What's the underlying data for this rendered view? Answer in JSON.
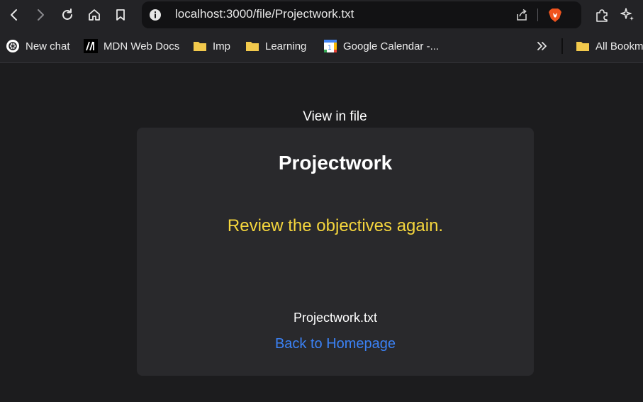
{
  "browser": {
    "url": "localhost:3000/file/Projectwork.txt",
    "bookmarks": [
      {
        "label": "New chat",
        "icon": "chatgpt-icon"
      },
      {
        "label": "MDN Web Docs",
        "icon": "mdn-icon"
      },
      {
        "label": "Imp",
        "icon": "folder-icon"
      },
      {
        "label": "Learning",
        "icon": "folder-icon"
      },
      {
        "label": "Google Calendar -...",
        "icon": "google-calendar-icon"
      }
    ],
    "all_bookmarks_label": "All Bookm"
  },
  "page": {
    "heading": "View in file",
    "title": "Projectwork",
    "body": "Review the objectives again.",
    "filename": "Projectwork.txt",
    "back_link": "Back to Homepage"
  },
  "colors": {
    "background": "#1c1c1e",
    "card": "#29292c",
    "body_text": "#f5d63d",
    "link": "#3b82f6",
    "folder": "#f2c94c"
  }
}
